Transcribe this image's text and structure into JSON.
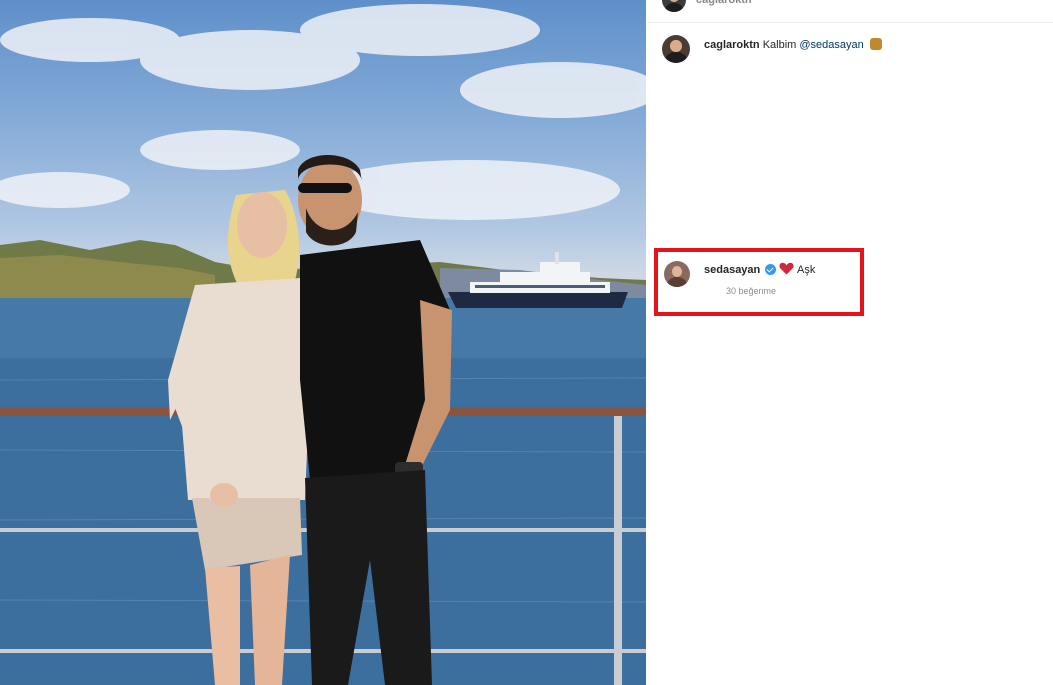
{
  "post": {
    "top_username": "caglaroktn",
    "caption": {
      "username": "caglaroktn",
      "text": "Kalbim",
      "mention": "@sedasayan",
      "emoji_icon": "gift-emoji-icon"
    },
    "comment": {
      "username": "sedasayan",
      "verified_icon": "verified-badge-icon",
      "heart_icon": "heart-emoji-icon",
      "text": "Aşk",
      "likes": "30 beğenme"
    }
  },
  "colors": {
    "highlight": "#e5141b",
    "mention": "#00376b",
    "verified": "#3897f0",
    "heart": "#d1263b"
  }
}
